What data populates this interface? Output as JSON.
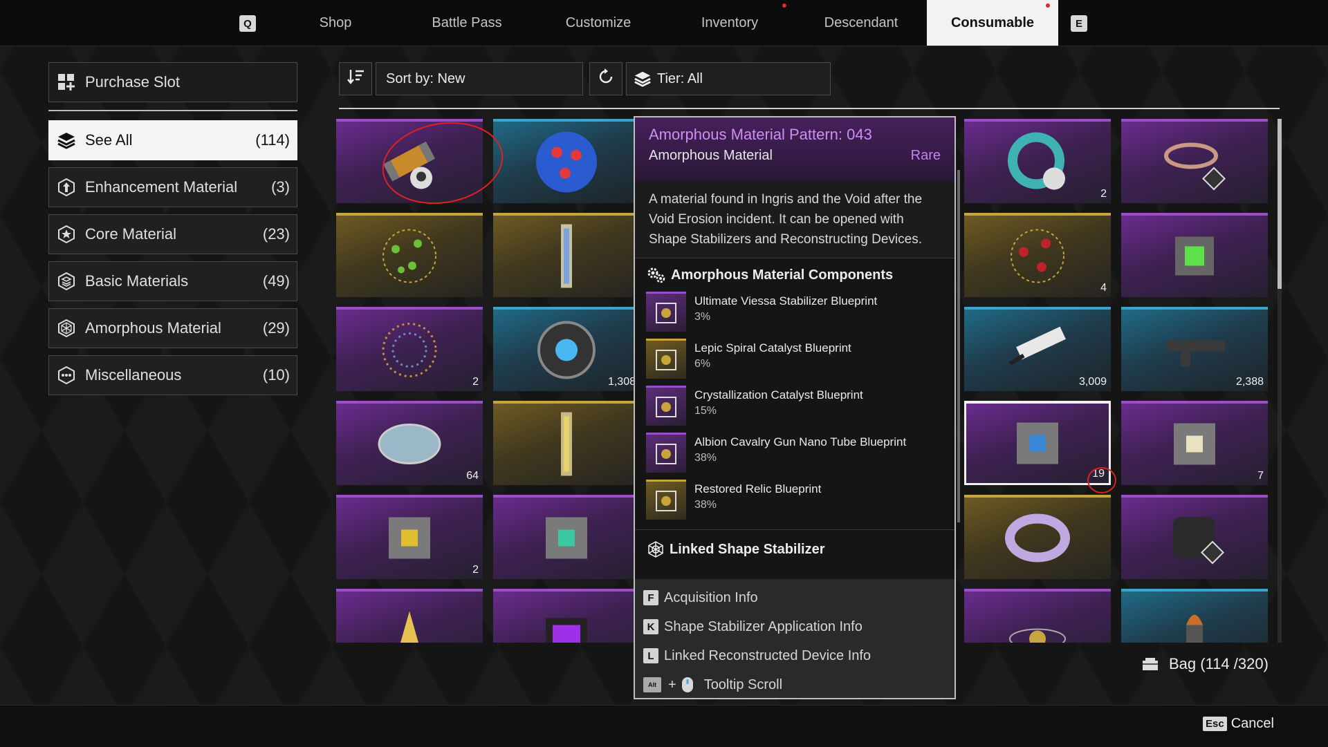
{
  "nav": {
    "left_key": "Q",
    "right_key": "E",
    "tabs": [
      "Shop",
      "Battle Pass",
      "Customize",
      "Inventory",
      "Descendant",
      "Consumable"
    ],
    "active_tab": "Consumable"
  },
  "sidebar": {
    "purchase_slot": "Purchase Slot",
    "items": [
      {
        "label": "See All",
        "count": "(114)",
        "icon": "layers-icon"
      },
      {
        "label": "Enhancement Material",
        "count": "(3)",
        "icon": "arrow-up-hexagon-icon"
      },
      {
        "label": "Core Material",
        "count": "(23)",
        "icon": "star-hexagon-icon"
      },
      {
        "label": "Basic Materials",
        "count": "(49)",
        "icon": "stack-hexagon-icon"
      },
      {
        "label": "Amorphous Material",
        "count": "(29)",
        "icon": "web-hexagon-icon"
      },
      {
        "label": "Miscellaneous",
        "count": "(10)",
        "icon": "dots-hexagon-icon"
      }
    ]
  },
  "toolbar": {
    "sort_label": "Sort by: New",
    "tier_label": "Tier: All"
  },
  "grid": {
    "tiles": [
      {
        "col": 0,
        "row": 0,
        "rarity": "purple",
        "icon": "cylinder-capsule-icon",
        "qty": ""
      },
      {
        "col": 1,
        "row": 0,
        "rarity": "blue",
        "icon": "blue-sphere-icon",
        "qty": ""
      },
      {
        "col": 4,
        "row": 0,
        "rarity": "purple",
        "icon": "teal-ring-icon",
        "qty": "2"
      },
      {
        "col": 5,
        "row": 0,
        "rarity": "purple",
        "icon": "cable-coil-icon",
        "qty": ""
      },
      {
        "col": 0,
        "row": 1,
        "rarity": "gold",
        "icon": "lattice-green-icon",
        "qty": ""
      },
      {
        "col": 1,
        "row": 1,
        "rarity": "gold",
        "icon": "crystal-rod-icon",
        "qty": ""
      },
      {
        "col": 4,
        "row": 1,
        "rarity": "gold",
        "icon": "lattice-red-icon",
        "qty": "4"
      },
      {
        "col": 5,
        "row": 1,
        "rarity": "purple",
        "icon": "green-cubes-icon",
        "qty": ""
      },
      {
        "col": 0,
        "row": 2,
        "rarity": "purple",
        "icon": "orange-lattice-icon",
        "qty": "2"
      },
      {
        "col": 1,
        "row": 2,
        "rarity": "blue",
        "icon": "reactor-core-icon",
        "qty": "1,308"
      },
      {
        "col": 4,
        "row": 2,
        "rarity": "blue",
        "icon": "white-device-icon",
        "qty": "3,009"
      },
      {
        "col": 5,
        "row": 2,
        "rarity": "blue",
        "icon": "gun-part-icon",
        "qty": "2,388"
      },
      {
        "col": 0,
        "row": 3,
        "rarity": "purple",
        "icon": "petri-disc-icon",
        "qty": "64"
      },
      {
        "col": 1,
        "row": 3,
        "rarity": "gold",
        "icon": "gold-rod-icon",
        "qty": ""
      },
      {
        "col": 4,
        "row": 3,
        "rarity": "purple",
        "icon": "blue-cubes-icon",
        "qty": "19",
        "selected": true
      },
      {
        "col": 5,
        "row": 3,
        "rarity": "purple",
        "icon": "white-cubes-icon",
        "qty": "7"
      },
      {
        "col": 0,
        "row": 4,
        "rarity": "purple",
        "icon": "yellow-cubes-icon",
        "qty": "2"
      },
      {
        "col": 1,
        "row": 4,
        "rarity": "purple",
        "icon": "teal-cubes-icon",
        "qty": ""
      },
      {
        "col": 4,
        "row": 4,
        "rarity": "gold",
        "icon": "rainbow-ring-icon",
        "qty": ""
      },
      {
        "col": 5,
        "row": 4,
        "rarity": "purple",
        "icon": "black-canister-icon",
        "qty": ""
      },
      {
        "col": 0,
        "row": 5,
        "rarity": "purple",
        "icon": "gold-spire-icon",
        "qty": ""
      },
      {
        "col": 1,
        "row": 5,
        "rarity": "purple",
        "icon": "purple-box-icon",
        "qty": ""
      },
      {
        "col": 4,
        "row": 5,
        "rarity": "purple",
        "icon": "orbit-icon",
        "qty": ""
      },
      {
        "col": 5,
        "row": 5,
        "rarity": "blue",
        "icon": "bullet-icon",
        "qty": ""
      }
    ]
  },
  "tooltip": {
    "title": "Amorphous Material Pattern: 043",
    "subtitle": "Amorphous Material",
    "grade": "Rare",
    "description": "A material found in Ingris and the Void after the Void Erosion incident. It can be opened with Shape Stabilizers and Reconstructing Devices.",
    "components_header": "Amorphous Material Components",
    "components": [
      {
        "name": "Ultimate Viessa Stabilizer Blueprint",
        "chance": "3%",
        "rarity": "purple"
      },
      {
        "name": "Lepic Spiral Catalyst Blueprint",
        "chance": "6%",
        "rarity": "gold"
      },
      {
        "name": "Crystallization Catalyst Blueprint",
        "chance": "15%",
        "rarity": "purple"
      },
      {
        "name": "Albion Cavalry Gun Nano Tube Blueprint",
        "chance": "38%",
        "rarity": "purple"
      },
      {
        "name": "Restored Relic Blueprint",
        "chance": "38%",
        "rarity": "gold"
      }
    ],
    "linked_header": "Linked Shape Stabilizer",
    "footer": [
      {
        "key": "F",
        "label": "Acquisition Info"
      },
      {
        "key": "K",
        "label": "Shape Stabilizer Application Info"
      },
      {
        "key": "L",
        "label": "Linked Reconstructed Device Info"
      }
    ],
    "scroll_key": "Alt",
    "scroll_plus": "+",
    "scroll_label": "Tooltip Scroll"
  },
  "bag": "Bag (114 /320)",
  "cancel": {
    "key": "Esc",
    "label": "Cancel"
  },
  "colors": {
    "accent_red": "#e02828",
    "rare_purple": "#c683ec"
  }
}
